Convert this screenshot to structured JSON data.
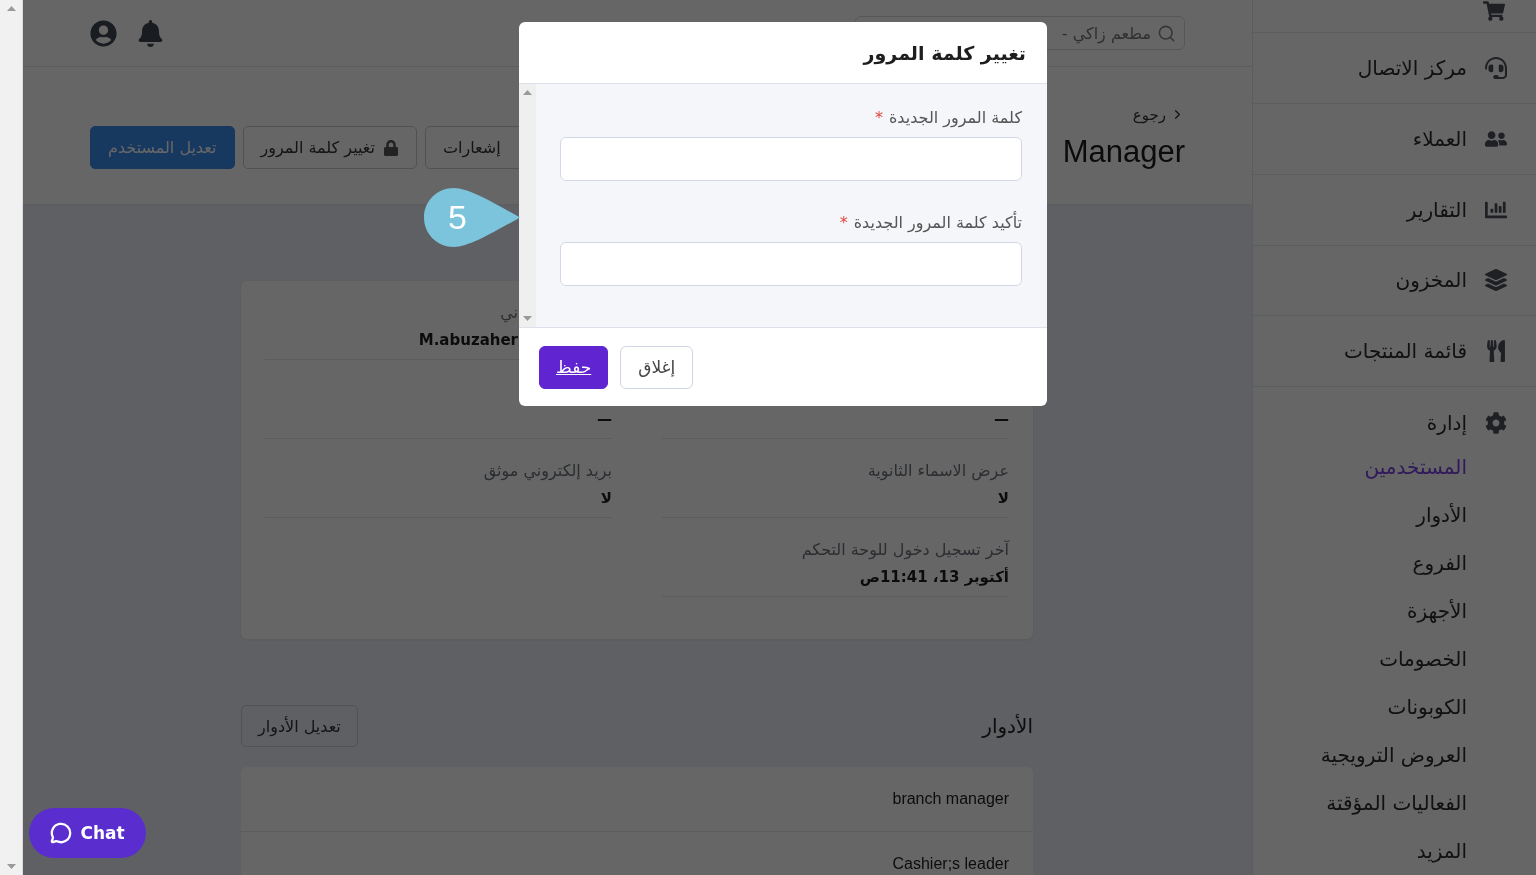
{
  "sidebar": {
    "items": [
      {
        "kind": "partial"
      },
      {
        "kind": "link",
        "label": "مركز الاتصال"
      },
      {
        "kind": "link",
        "label": "العملاء"
      },
      {
        "kind": "link",
        "label": "التقارير"
      },
      {
        "kind": "link",
        "label": "المخزون"
      },
      {
        "kind": "link",
        "label": "قائمة المنتجات"
      },
      {
        "kind": "group",
        "label": "إدارة",
        "children": [
          {
            "label": "المستخدمين",
            "selected": true
          },
          {
            "label": "الأدوار",
            "selected": false
          },
          {
            "label": "الفروع",
            "selected": false
          },
          {
            "label": "الأجهزة",
            "selected": false
          },
          {
            "label": "الخصومات",
            "selected": false
          },
          {
            "label": "الكوبونات",
            "selected": false
          },
          {
            "label": "العروض الترويجية",
            "selected": false
          },
          {
            "label": "الفعاليات المؤقتة",
            "selected": false
          },
          {
            "label": "المزيد",
            "selected": false
          }
        ]
      }
    ]
  },
  "topbar": {
    "search": {
      "value": "مطعم زاكي -"
    }
  },
  "header": {
    "back_link": "رجوع",
    "title": "Manager",
    "buttons": [
      {
        "kind": "plain",
        "label": "إشعارات"
      },
      {
        "kind": "lock",
        "label": "تغيير كلمة المرور"
      },
      {
        "kind": "primary",
        "label": "تعديل المستخدم"
      }
    ]
  },
  "details": {
    "rows": [
      [
        {
          "kind": "empty"
        },
        {
          "kind": "partial",
          "label": "ني",
          "value": "M.abuzaher"
        }
      ],
      [
        {
          "kind": "value",
          "value": "—"
        },
        {
          "kind": "value",
          "value": "—"
        }
      ],
      [
        {
          "kind": "full",
          "label": "عرض الاسماء الثانوية",
          "value": "لا"
        },
        {
          "kind": "full",
          "label": "بريد إلكتروني موثق",
          "value": "لا"
        }
      ],
      [
        {
          "kind": "full",
          "label": "آخر تسجيل دخول للوحة التحكم",
          "value": "أكتوبر 13، 11:41ص"
        },
        {
          "kind": "blank"
        }
      ]
    ]
  },
  "roles": {
    "title": "الأدوار",
    "edit_button": "تعديل الأدوار",
    "items": [
      "branch manager",
      "Cashier;s leader"
    ]
  },
  "modal": {
    "title": "تغيير كلمة المرور",
    "fields": [
      {
        "label": "كلمة المرور الجديدة",
        "mark": "*"
      },
      {
        "label": "تأكيد كلمة المرور الجديدة",
        "mark": "*"
      }
    ],
    "buttons": [
      {
        "kind": "secondary",
        "label": "إغلاق"
      },
      {
        "kind": "primary",
        "label": "حفظ"
      }
    ]
  },
  "callout": {
    "step": "5"
  },
  "chat": {
    "label": "Chat"
  }
}
